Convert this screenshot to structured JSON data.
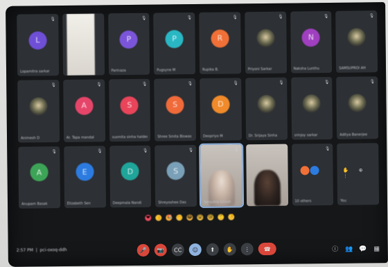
{
  "meeting": {
    "time": "2:57 PM",
    "code": "pci-oxoq-ddh"
  },
  "tiles": [
    {
      "name": "Lopamitra sarkar",
      "avatar_color": "#6f4fd6",
      "initial": "L"
    },
    {
      "name": "",
      "avatar_color": "",
      "initial": "",
      "kind": "blank"
    },
    {
      "name": "Parinaza",
      "avatar_color": "#7b55d9",
      "initial": "P"
    },
    {
      "name": "Pugsyne M",
      "avatar_color": "#2ab7c4",
      "initial": "P"
    },
    {
      "name": "Rupika B.",
      "avatar_color": "#f07037",
      "initial": "R"
    },
    {
      "name": "Priyoni Sarkar",
      "avatar_color": "",
      "initial": "",
      "kind": "photo"
    },
    {
      "name": "Naksha Lunthu",
      "avatar_color": "#a03fc0",
      "initial": "N"
    },
    {
      "name": "SAMSUPROI AH",
      "avatar_color": "",
      "initial": "",
      "kind": "photo"
    },
    {
      "name": "Animesh D",
      "avatar_color": "",
      "initial": "",
      "kind": "photo"
    },
    {
      "name": "Ar. Tapa mandal",
      "avatar_color": "#e6456a",
      "initial": "A"
    },
    {
      "name": "susmita sinha halder",
      "avatar_color": "#e8445a",
      "initial": "S"
    },
    {
      "name": "Shree Smita Biswas",
      "avatar_color": "#f06a3a",
      "initial": "S"
    },
    {
      "name": "Deopriyo M",
      "avatar_color": "#f08a2a",
      "initial": "D"
    },
    {
      "name": "Dr. Srijaya Sinha",
      "avatar_color": "",
      "initial": "",
      "kind": "photo"
    },
    {
      "name": "srinjoy sarkar",
      "avatar_color": "",
      "initial": "",
      "kind": "photo"
    },
    {
      "name": "Aditya Banerjee",
      "avatar_color": "",
      "initial": "",
      "kind": "photo"
    },
    {
      "name": "Anupam Basak",
      "avatar_color": "#3da457",
      "initial": "A"
    },
    {
      "name": "Elizabeth Sen",
      "avatar_color": "#2c7be0",
      "initial": "E"
    },
    {
      "name": "Deepmala Nandi",
      "avatar_color": "#1fa59a",
      "initial": "D"
    },
    {
      "name": "Shreyoshee Das",
      "avatar_color": "#7aa0b8",
      "initial": "S"
    },
    {
      "name": "Sanjukta Ghosh",
      "avatar_color": "",
      "initial": "",
      "kind": "video-light"
    },
    {
      "name": "",
      "avatar_color": "",
      "initial": "",
      "kind": "video-dark"
    },
    {
      "name": "10 others",
      "avatar_color": "",
      "initial": "",
      "kind": "others"
    },
    {
      "name": "You",
      "avatar_color": "",
      "initial": "",
      "kind": "you"
    }
  ],
  "reactions": [
    "❤",
    "👍",
    "🎉",
    "👏",
    "😂",
    "😮",
    "😢",
    "🤔",
    "👎"
  ],
  "controls": {
    "mic": "🎤",
    "camera": "📷",
    "captions": "CC",
    "hand": "✋",
    "present": "⬆",
    "more": "⋮",
    "end": "☎"
  },
  "right_controls": [
    "ⓘ",
    "👥",
    "💬",
    "▦"
  ],
  "colors": {
    "screen_bg": "#151719",
    "tile_bg": "#2d3034",
    "accent": "#8fb3e0",
    "danger": "#d8473a"
  }
}
